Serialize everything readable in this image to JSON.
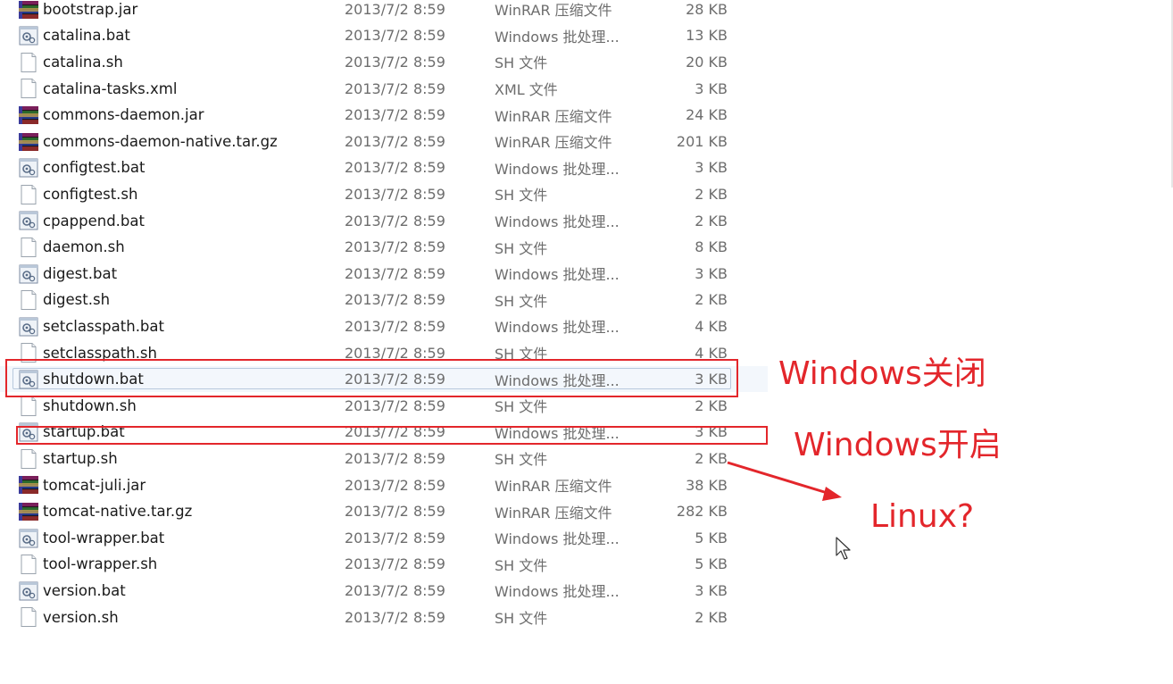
{
  "files": [
    {
      "name": "bootstrap.jar",
      "date": "2013/7/2 8:59",
      "type": "WinRAR 压缩文件",
      "size": "28 KB",
      "icon": "winrar-archive-icon"
    },
    {
      "name": "catalina.bat",
      "date": "2013/7/2 8:59",
      "type": "Windows 批处理...",
      "size": "13 KB",
      "icon": "batch-file-icon"
    },
    {
      "name": "catalina.sh",
      "date": "2013/7/2 8:59",
      "type": "SH 文件",
      "size": "20 KB",
      "icon": "blank-file-icon"
    },
    {
      "name": "catalina-tasks.xml",
      "date": "2013/7/2 8:59",
      "type": "XML 文件",
      "size": "3 KB",
      "icon": "blank-file-icon"
    },
    {
      "name": "commons-daemon.jar",
      "date": "2013/7/2 8:59",
      "type": "WinRAR 压缩文件",
      "size": "24 KB",
      "icon": "winrar-archive-icon"
    },
    {
      "name": "commons-daemon-native.tar.gz",
      "date": "2013/7/2 8:59",
      "type": "WinRAR 压缩文件",
      "size": "201 KB",
      "icon": "winrar-archive-icon"
    },
    {
      "name": "configtest.bat",
      "date": "2013/7/2 8:59",
      "type": "Windows 批处理...",
      "size": "3 KB",
      "icon": "batch-file-icon"
    },
    {
      "name": "configtest.sh",
      "date": "2013/7/2 8:59",
      "type": "SH 文件",
      "size": "2 KB",
      "icon": "blank-file-icon"
    },
    {
      "name": "cpappend.bat",
      "date": "2013/7/2 8:59",
      "type": "Windows 批处理...",
      "size": "2 KB",
      "icon": "batch-file-icon"
    },
    {
      "name": "daemon.sh",
      "date": "2013/7/2 8:59",
      "type": "SH 文件",
      "size": "8 KB",
      "icon": "blank-file-icon"
    },
    {
      "name": "digest.bat",
      "date": "2013/7/2 8:59",
      "type": "Windows 批处理...",
      "size": "3 KB",
      "icon": "batch-file-icon"
    },
    {
      "name": "digest.sh",
      "date": "2013/7/2 8:59",
      "type": "SH 文件",
      "size": "2 KB",
      "icon": "blank-file-icon"
    },
    {
      "name": "setclasspath.bat",
      "date": "2013/7/2 8:59",
      "type": "Windows 批处理...",
      "size": "4 KB",
      "icon": "batch-file-icon"
    },
    {
      "name": "setclasspath.sh",
      "date": "2013/7/2 8:59",
      "type": "SH 文件",
      "size": "4 KB",
      "icon": "blank-file-icon"
    },
    {
      "name": "shutdown.bat",
      "date": "2013/7/2 8:59",
      "type": "Windows 批处理...",
      "size": "3 KB",
      "icon": "batch-file-icon"
    },
    {
      "name": "shutdown.sh",
      "date": "2013/7/2 8:59",
      "type": "SH 文件",
      "size": "2 KB",
      "icon": "blank-file-icon"
    },
    {
      "name": "startup.bat",
      "date": "2013/7/2 8:59",
      "type": "Windows 批处理...",
      "size": "3 KB",
      "icon": "batch-file-icon"
    },
    {
      "name": "startup.sh",
      "date": "2013/7/2 8:59",
      "type": "SH 文件",
      "size": "2 KB",
      "icon": "blank-file-icon"
    },
    {
      "name": "tomcat-juli.jar",
      "date": "2013/7/2 8:59",
      "type": "WinRAR 压缩文件",
      "size": "38 KB",
      "icon": "winrar-archive-icon"
    },
    {
      "name": "tomcat-native.tar.gz",
      "date": "2013/7/2 8:59",
      "type": "WinRAR 压缩文件",
      "size": "282 KB",
      "icon": "winrar-archive-icon"
    },
    {
      "name": "tool-wrapper.bat",
      "date": "2013/7/2 8:59",
      "type": "Windows 批处理...",
      "size": "5 KB",
      "icon": "batch-file-icon"
    },
    {
      "name": "tool-wrapper.sh",
      "date": "2013/7/2 8:59",
      "type": "SH 文件",
      "size": "5 KB",
      "icon": "blank-file-icon"
    },
    {
      "name": "version.bat",
      "date": "2013/7/2 8:59",
      "type": "Windows 批处理...",
      "size": "3 KB",
      "icon": "batch-file-icon"
    },
    {
      "name": "version.sh",
      "date": "2013/7/2 8:59",
      "type": "SH 文件",
      "size": "2 KB",
      "icon": "blank-file-icon"
    }
  ],
  "selected_file": "shutdown.bat",
  "annotations": {
    "windows_close": "Windows关闭",
    "windows_open": "Windows开启",
    "linux": "Linux?"
  },
  "colors": {
    "annotation_red": "#e3262b",
    "selection_bg": "#f3f7fc",
    "secondary_text": "#6d6d6d"
  }
}
